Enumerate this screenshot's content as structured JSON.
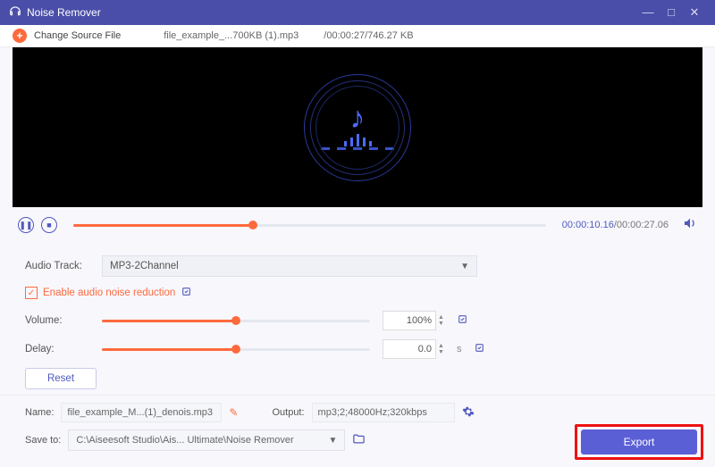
{
  "titlebar": {
    "title": "Noise Remover"
  },
  "toolbar": {
    "change_source": "Change Source File",
    "filename": "file_example_...700KB (1).mp3",
    "meta": "/00:00:27/746.27 KB"
  },
  "player": {
    "current_time": "00:00:10.16",
    "total_time": "/00:00:27.06",
    "progress_pct": 38
  },
  "audio": {
    "track_label": "Audio Track:",
    "track_value": "MP3-2Channel",
    "enable_noise_label": "Enable audio noise reduction",
    "volume_label": "Volume:",
    "volume_value": "100%",
    "volume_pct": 50,
    "delay_label": "Delay:",
    "delay_value": "0.0",
    "delay_unit": "s",
    "delay_pct": 50,
    "reset_label": "Reset"
  },
  "footer": {
    "name_label": "Name:",
    "name_value": "file_example_M...(1)_denois.mp3",
    "output_label": "Output:",
    "output_value": "mp3;2;48000Hz;320kbps",
    "save_label": "Save to:",
    "save_value": "C:\\Aiseesoft Studio\\Ais... Ultimate\\Noise Remover",
    "export_label": "Export"
  }
}
